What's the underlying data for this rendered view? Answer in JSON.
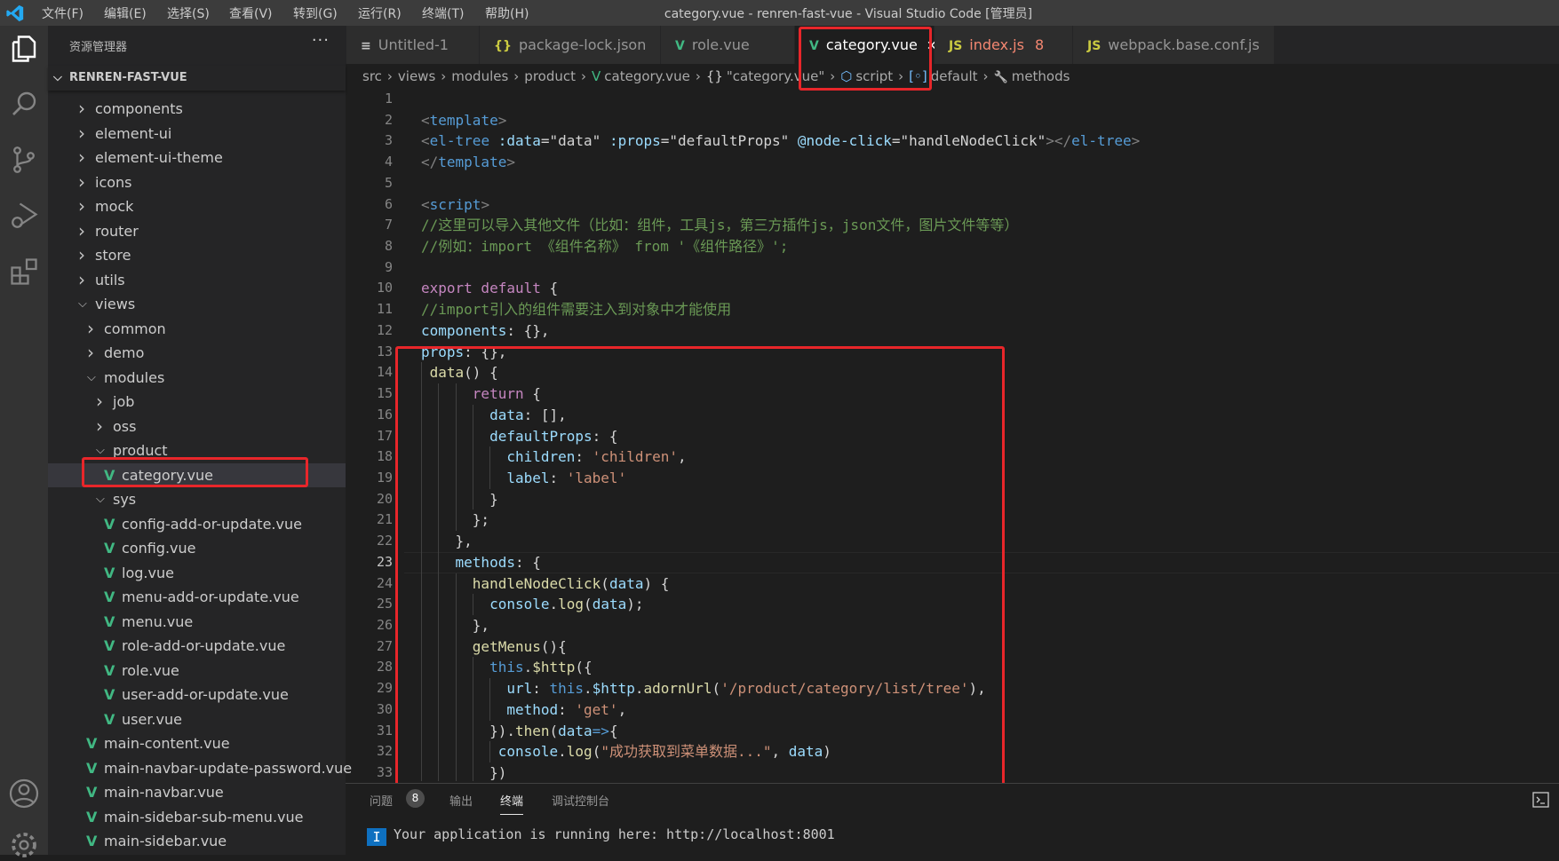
{
  "titlebar": {
    "menus": [
      "文件(F)",
      "编辑(E)",
      "选择(S)",
      "查看(V)",
      "转到(G)",
      "运行(R)",
      "终端(T)",
      "帮助(H)"
    ],
    "title": "category.vue - renren-fast-vue - Visual Studio Code [管理员]"
  },
  "activity": {
    "icons": [
      "files-icon",
      "search-icon",
      "source-control-icon",
      "run-debug-icon",
      "extensions-icon",
      "account-icon",
      "settings-gear-icon"
    ]
  },
  "sidebar": {
    "header": "资源管理器",
    "more": "···",
    "root": "RENREN-FAST-VUE",
    "items": [
      {
        "label": "components",
        "level": 0,
        "type": "folder",
        "open": false
      },
      {
        "label": "element-ui",
        "level": 0,
        "type": "folder",
        "open": false
      },
      {
        "label": "element-ui-theme",
        "level": 0,
        "type": "folder",
        "open": false
      },
      {
        "label": "icons",
        "level": 0,
        "type": "folder",
        "open": false
      },
      {
        "label": "mock",
        "level": 0,
        "type": "folder",
        "open": false
      },
      {
        "label": "router",
        "level": 0,
        "type": "folder",
        "open": false
      },
      {
        "label": "store",
        "level": 0,
        "type": "folder",
        "open": false
      },
      {
        "label": "utils",
        "level": 0,
        "type": "folder",
        "open": false
      },
      {
        "label": "views",
        "level": 0,
        "type": "folder",
        "open": true
      },
      {
        "label": "common",
        "level": 1,
        "type": "folder",
        "open": false
      },
      {
        "label": "demo",
        "level": 1,
        "type": "folder",
        "open": false
      },
      {
        "label": "modules",
        "level": 1,
        "type": "folder",
        "open": true
      },
      {
        "label": "job",
        "level": 2,
        "type": "folder",
        "open": false
      },
      {
        "label": "oss",
        "level": 2,
        "type": "folder",
        "open": false
      },
      {
        "label": "product",
        "level": 2,
        "type": "folder",
        "open": true
      },
      {
        "label": "category.vue",
        "level": 3,
        "type": "vue",
        "selected": true
      },
      {
        "label": "sys",
        "level": 2,
        "type": "folder",
        "open": true
      },
      {
        "label": "config-add-or-update.vue",
        "level": 3,
        "type": "vue"
      },
      {
        "label": "config.vue",
        "level": 3,
        "type": "vue"
      },
      {
        "label": "log.vue",
        "level": 3,
        "type": "vue"
      },
      {
        "label": "menu-add-or-update.vue",
        "level": 3,
        "type": "vue"
      },
      {
        "label": "menu.vue",
        "level": 3,
        "type": "vue"
      },
      {
        "label": "role-add-or-update.vue",
        "level": 3,
        "type": "vue"
      },
      {
        "label": "role.vue",
        "level": 3,
        "type": "vue"
      },
      {
        "label": "user-add-or-update.vue",
        "level": 3,
        "type": "vue"
      },
      {
        "label": "user.vue",
        "level": 3,
        "type": "vue"
      },
      {
        "label": "main-content.vue",
        "level": 1,
        "type": "vue"
      },
      {
        "label": "main-navbar-update-password.vue",
        "level": 1,
        "type": "vue"
      },
      {
        "label": "main-navbar.vue",
        "level": 1,
        "type": "vue"
      },
      {
        "label": "main-sidebar-sub-menu.vue",
        "level": 1,
        "type": "vue"
      },
      {
        "label": "main-sidebar.vue",
        "level": 1,
        "type": "vue"
      }
    ]
  },
  "tabs": [
    {
      "label": "Untitled-1",
      "icon": "≡",
      "icon_color": "#c5c5c5",
      "active": false
    },
    {
      "label": "package-lock.json",
      "icon": "{}",
      "icon_color": "#cbcb41",
      "active": false
    },
    {
      "label": "role.vue",
      "icon": "V",
      "icon_color": "#41b883",
      "active": false
    },
    {
      "label": "category.vue",
      "icon": "V",
      "icon_color": "#41b883",
      "active": true,
      "close": "✕"
    },
    {
      "label": "index.js",
      "icon": "JS",
      "icon_color": "#cbcb41",
      "active": false,
      "label_color": "#f48771",
      "badge": "8"
    },
    {
      "label": "webpack.base.conf.js",
      "icon": "JS",
      "icon_color": "#cbcb41",
      "active": false
    }
  ],
  "breadcrumb": [
    "src",
    "views",
    "modules",
    "product",
    "category.vue",
    "\"category.vue\"",
    "script",
    "default",
    "methods"
  ],
  "editor": {
    "current_line": 23,
    "lines": [
      [],
      [
        [
          "<",
          "br"
        ],
        [
          "template",
          "tag"
        ],
        [
          ">",
          "br"
        ]
      ],
      [
        [
          "<",
          "br"
        ],
        [
          "el-tree",
          "tag"
        ],
        [
          " :data",
          "attr"
        ],
        [
          "=",
          "tx"
        ],
        [
          "\"data\"",
          "tx"
        ],
        [
          " :props",
          "attr"
        ],
        [
          "=",
          "tx"
        ],
        [
          "\"defaultProps\"",
          "tx"
        ],
        [
          " @node-click",
          "attr"
        ],
        [
          "=",
          "tx"
        ],
        [
          "\"handleNodeClick\"",
          "tx"
        ],
        [
          "></",
          "br"
        ],
        [
          "el-tree",
          "tag"
        ],
        [
          ">",
          "br"
        ]
      ],
      [
        [
          "</",
          "br"
        ],
        [
          "template",
          "tag"
        ],
        [
          ">",
          "br"
        ]
      ],
      [],
      [
        [
          "<",
          "br"
        ],
        [
          "script",
          "tag"
        ],
        [
          ">",
          "br"
        ]
      ],
      [
        [
          "//这里可以导入其他文件（比如：组件，工具js，第三方插件js，json文件，图片文件等等）",
          "cm"
        ]
      ],
      [
        [
          "//例如：import 《组件名称》 from '《组件路径》';",
          "cm"
        ]
      ],
      [],
      [
        [
          "export default",
          "kw"
        ],
        [
          " {",
          "tx"
        ]
      ],
      [
        [
          "//import引入的组件需要注入到对象中才能使用",
          "cm"
        ]
      ],
      [
        [
          "components",
          "prop"
        ],
        [
          ": {},",
          "tx"
        ]
      ],
      [
        [
          "props",
          "prop"
        ],
        [
          ": {},",
          "tx"
        ]
      ],
      [
        [
          " ",
          "tx"
        ],
        [
          "data",
          "fn"
        ],
        [
          "() {",
          "tx"
        ]
      ],
      [
        [
          "      ",
          "tx"
        ],
        [
          "return",
          "kw"
        ],
        [
          " {",
          "tx"
        ]
      ],
      [
        [
          "        ",
          "tx"
        ],
        [
          "data",
          "prop"
        ],
        [
          ": [],",
          "tx"
        ]
      ],
      [
        [
          "        ",
          "tx"
        ],
        [
          "defaultProps",
          "prop"
        ],
        [
          ": {",
          "tx"
        ]
      ],
      [
        [
          "          ",
          "tx"
        ],
        [
          "children",
          "prop"
        ],
        [
          ": ",
          "tx"
        ],
        [
          "'children'",
          "str"
        ],
        [
          ",",
          "tx"
        ]
      ],
      [
        [
          "          ",
          "tx"
        ],
        [
          "label",
          "prop"
        ],
        [
          ": ",
          "tx"
        ],
        [
          "'label'",
          "str"
        ]
      ],
      [
        [
          "        }",
          "tx"
        ]
      ],
      [
        [
          "      };",
          "tx"
        ]
      ],
      [
        [
          "    },",
          "tx"
        ]
      ],
      [
        [
          "    ",
          "tx"
        ],
        [
          "methods",
          "prop"
        ],
        [
          ": ",
          "tx"
        ],
        [
          "{",
          "bm"
        ]
      ],
      [
        [
          "      ",
          "tx"
        ],
        [
          "handleNodeClick",
          "fn"
        ],
        [
          "(",
          "tx"
        ],
        [
          "data",
          "prop"
        ],
        [
          ") {",
          "tx"
        ]
      ],
      [
        [
          "        ",
          "tx"
        ],
        [
          "console",
          "prop"
        ],
        [
          ".",
          "tx"
        ],
        [
          "log",
          "fn"
        ],
        [
          "(",
          "tx"
        ],
        [
          "data",
          "prop"
        ],
        [
          ");",
          "tx"
        ]
      ],
      [
        [
          "      },",
          "tx"
        ]
      ],
      [
        [
          "      ",
          "tx"
        ],
        [
          "getMenus",
          "fn"
        ],
        [
          "(){",
          "tx"
        ]
      ],
      [
        [
          "        ",
          "tx"
        ],
        [
          "this",
          "this"
        ],
        [
          ".",
          "tx"
        ],
        [
          "$http",
          "fn"
        ],
        [
          "({",
          "tx"
        ]
      ],
      [
        [
          "          ",
          "tx"
        ],
        [
          "url",
          "prop"
        ],
        [
          ": ",
          "tx"
        ],
        [
          "this",
          "this"
        ],
        [
          ".",
          "tx"
        ],
        [
          "$http",
          "prop"
        ],
        [
          ".",
          "tx"
        ],
        [
          "adornUrl",
          "fn"
        ],
        [
          "(",
          "tx"
        ],
        [
          "'/product/category/list/tree'",
          "str"
        ],
        [
          "),",
          "tx"
        ]
      ],
      [
        [
          "          ",
          "tx"
        ],
        [
          "method",
          "prop"
        ],
        [
          ": ",
          "tx"
        ],
        [
          "'get'",
          "str"
        ],
        [
          ",",
          "tx"
        ]
      ],
      [
        [
          "        }).",
          "tx"
        ],
        [
          "then",
          "fn"
        ],
        [
          "(",
          "tx"
        ],
        [
          "data",
          "prop"
        ],
        [
          "=>",
          "this"
        ],
        [
          "{",
          "tx"
        ]
      ],
      [
        [
          "         ",
          "tx"
        ],
        [
          "console",
          "prop"
        ],
        [
          ".",
          "tx"
        ],
        [
          "log",
          "fn"
        ],
        [
          "(",
          "tx"
        ],
        [
          "\"成功获取到菜单数据...\"",
          "str"
        ],
        [
          ", ",
          "tx"
        ],
        [
          "data",
          "prop"
        ],
        [
          ")",
          "tx"
        ]
      ],
      [
        [
          "        })",
          "tx"
        ]
      ]
    ]
  },
  "panel": {
    "tabs": [
      {
        "label": "问题",
        "badge": "8"
      },
      {
        "label": "输出"
      },
      {
        "label": "终端",
        "active": true
      },
      {
        "label": "调试控制台"
      }
    ],
    "terminal_cursor": "I",
    "terminal_line": "Your application is running here: http://localhost:8001"
  },
  "colors": {
    "highlight_box": "#e8262a",
    "vue_icon": "#41b883",
    "accent": "#0e70c0"
  }
}
